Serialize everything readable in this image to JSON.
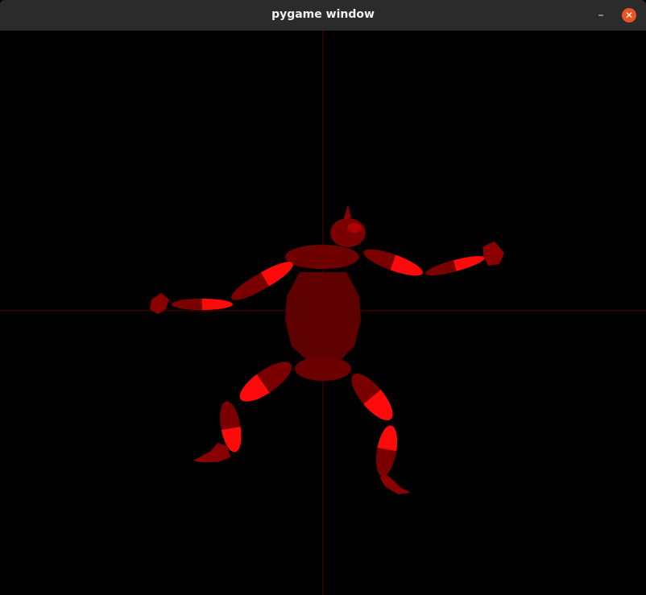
{
  "window": {
    "title": "pygame window",
    "minimize_glyph": "–",
    "close_glyph": "✕"
  },
  "scene": {
    "background_color": "#000000",
    "axis_color": "#5a0000",
    "figure_dark_color": "#5e0000",
    "figure_mid_color": "#8a0000",
    "figure_bright_color": "#ff0a0a",
    "titlebar_color": "#2b2b2b",
    "close_button_color": "#e95420"
  }
}
